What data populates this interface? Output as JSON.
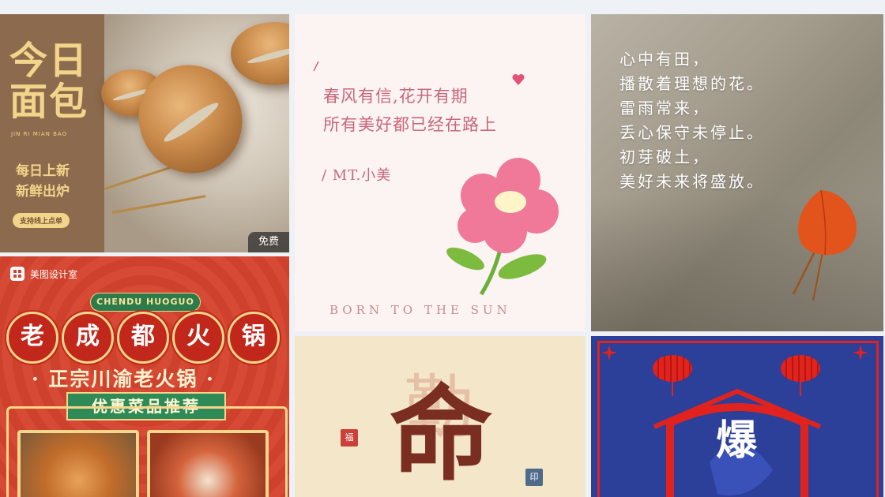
{
  "colors": {
    "page_bg": "#eef1f5",
    "badge_bg": "#333333",
    "accent_red": "#d5432d",
    "gold": "#f2d48a"
  },
  "cards": {
    "bread": {
      "title_line1": "今日",
      "title_line2": "面包",
      "pinyin": "JIN RI MIAN BAO",
      "promo_line1": "每日上新",
      "promo_line2": "新鲜出炉",
      "pill": "支持线上点单",
      "badge": "免费"
    },
    "poem": {
      "line1": "春风有信,花开有期",
      "line2": "所有美好都已经在路上",
      "signature": "/ MT.小美",
      "footer": "BORN TO THE SUN"
    },
    "stone": {
      "lines": [
        "心中有田，",
        "播散着理想的花。",
        "雷雨常来，",
        "丢心保守未停止。",
        "初芽破土，",
        "美好未来将盛放。"
      ]
    },
    "hotpot": {
      "brand": "美图设计室",
      "ribbon": "CHENDU HUOGUO",
      "coins": [
        "老",
        "成",
        "都",
        "火",
        "锅"
      ],
      "tagline": "· 正宗川渝老火锅 ·",
      "banner": "优惠菜品推荐"
    },
    "calligraphy": {
      "ghost_char": "勤",
      "main_char": "命",
      "seal_left": "福",
      "seal_right": "印"
    },
    "cny": {
      "main_char": "爆"
    }
  }
}
